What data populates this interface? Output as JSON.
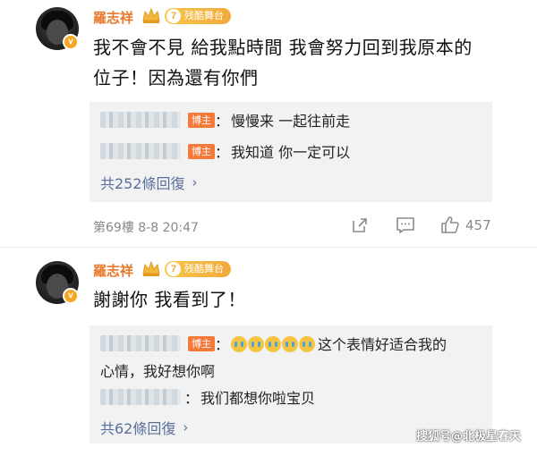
{
  "posts": [
    {
      "author": "羅志祥",
      "level_number": "7",
      "level_label": "残酷舞台",
      "verified_mark": "v",
      "content_line1": "我不會不見 給我點時間 我會努力回到我原本的",
      "content_line2": "位子！因為還有你們",
      "replies": [
        {
          "sep": "：",
          "text": "慢慢来 一起往前走",
          "host_tag": "博主"
        },
        {
          "sep": "：",
          "text": "我知道 你一定可以",
          "host_tag": "博主"
        }
      ],
      "more_replies": "共252條回復",
      "floor_time": "第69樓 8-8 20:47",
      "like_count": "457"
    },
    {
      "author": "羅志祥",
      "level_number": "7",
      "level_label": "残酷舞台",
      "verified_mark": "v",
      "content_line1": "謝謝你 我看到了！",
      "replies": [
        {
          "sep": "：",
          "text": "这个表情好适合我的",
          "text_cont": "心情，我好想你啊",
          "host_tag": "博主"
        },
        {
          "sep": "：",
          "text": "我们都想你啦宝贝"
        }
      ],
      "more_replies": "共62條回復"
    }
  ],
  "icons": {
    "more_chevron": "chevron-right-icon",
    "share": "share-icon",
    "comment": "comment-icon",
    "like": "thumbs-up-icon"
  },
  "colors": {
    "author_name": "#e8782b",
    "host_tag": "#f47a3a",
    "link_blue": "#5a6f9a",
    "reply_bg": "#f2f2f2"
  },
  "watermark": "搜狐号@北极星春天"
}
